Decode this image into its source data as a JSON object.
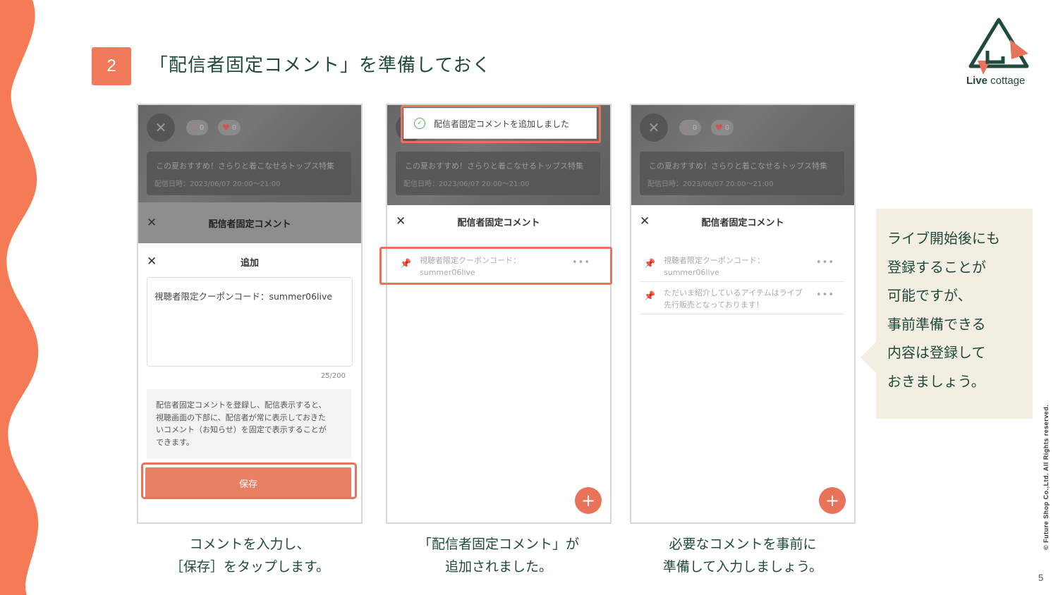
{
  "step_number": "2",
  "slide_title": "「配信者固定コメント」を準備しておく",
  "logo": {
    "brand_bold": "Live",
    "brand_light": " cottage"
  },
  "live_header": {
    "viewers": "0",
    "likes": "0",
    "event_title": "この夏おすすめ！さらりと着こなせるトップス特集",
    "event_date": "配信日時：2023/06/07 20:00〜21:00"
  },
  "panel_title": "配信者固定コメント",
  "add_title": "追加",
  "comment_input_value": "視聴者限定クーポンコード：summer06live",
  "char_counter": "25/200",
  "info_text": "配信者固定コメントを登録し、配信表示すると、\n視聴画面の下部に、配信者が常に表示しておきた\nいコメント（お知らせ）を固定で表示することが\nできます。",
  "save_label": "保存",
  "toast_text": "配信者固定コメントを追加しました",
  "pinned_comments": [
    {
      "text": "視聴者限定クーポンコード：\nsummer06live"
    },
    {
      "text": "ただいま紹介しているアイテムはライブ\n先行販売となっております！"
    }
  ],
  "more_label": "•••",
  "fab_label": "+",
  "close_label": "✕",
  "captions": [
    {
      "line1": "コメントを入力し、",
      "line2": "［保存］をタップします。"
    },
    {
      "line1": "「配信者固定コメント」が",
      "line2": "追加されました。"
    },
    {
      "line1": "必要なコメントを事前に",
      "line2": "準備して入力しましょう。"
    }
  ],
  "note_lines": [
    "ライブ開始後にも",
    "登録することが",
    "可能ですが、",
    "事前準備できる",
    "内容は登録して",
    "おきましょう。"
  ],
  "copyright": "© Future Shop Co.,Ltd. All Rights reserved.",
  "page_number": "5",
  "colors": {
    "accent": "#e8735a",
    "dark_green": "#1f4a3c",
    "note_bg": "#f3eee2"
  }
}
